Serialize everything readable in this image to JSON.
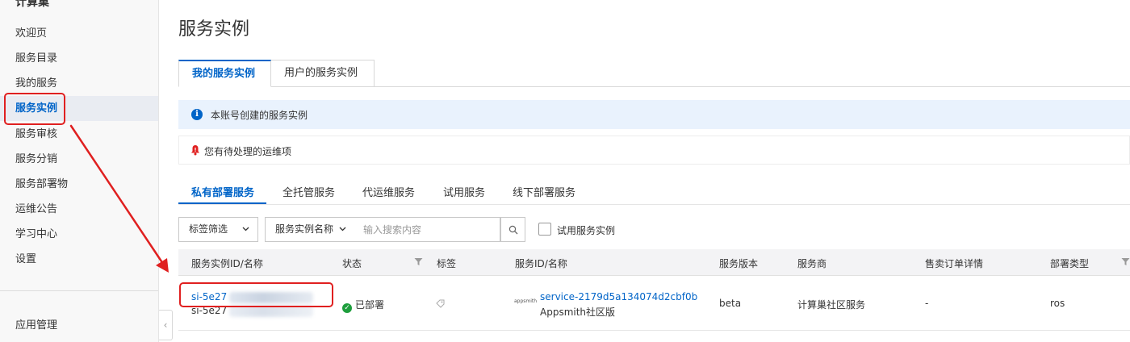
{
  "sidebar": {
    "title": "计算巢",
    "items": [
      {
        "label": "欢迎页"
      },
      {
        "label": "服务目录"
      },
      {
        "label": "我的服务"
      },
      {
        "label": "服务实例"
      },
      {
        "label": "服务审核"
      },
      {
        "label": "服务分销"
      },
      {
        "label": "服务部署物"
      },
      {
        "label": "运维公告"
      },
      {
        "label": "学习中心"
      },
      {
        "label": "设置"
      }
    ],
    "active_index": 3,
    "bottom_item": "应用管理",
    "collapse_glyph": "‹"
  },
  "page": {
    "title": "服务实例"
  },
  "top_tabs": [
    {
      "label": "我的服务实例"
    },
    {
      "label": "用户的服务实例"
    }
  ],
  "info_banner": {
    "icon": "i",
    "text": "本账号创建的服务实例"
  },
  "alert_banner": {
    "text": "您有待处理的运维项"
  },
  "sub_tabs": [
    {
      "label": "私有部署服务"
    },
    {
      "label": "全托管服务"
    },
    {
      "label": "代运维服务"
    },
    {
      "label": "试用服务"
    },
    {
      "label": "线下部署服务"
    }
  ],
  "filters": {
    "tag_filter": "标签筛选",
    "name_select": "服务实例名称",
    "search_placeholder": "输入搜索内容",
    "trial_checkbox_label": "试用服务实例",
    "trial_checked": false
  },
  "table": {
    "columns": [
      "服务实例ID/名称",
      "状态",
      "标签",
      "服务ID/名称",
      "服务版本",
      "服务商",
      "售卖订单详情",
      "部署类型"
    ],
    "rows": [
      {
        "instance_id": "si-5e27",
        "instance_name": "si-5e27",
        "status": "已部署",
        "status_glyph": "✓",
        "service_logo": "appsmith",
        "service_id": "service-2179d5a134074d2cbf0b",
        "service_name": "Appsmith社区版",
        "version": "beta",
        "provider": "计算巢社区服务",
        "order_detail": "-",
        "deploy_type": "ros"
      }
    ]
  },
  "colors": {
    "accent": "#0064c8",
    "annotation": "#e02020",
    "success": "#1e9e3d"
  }
}
